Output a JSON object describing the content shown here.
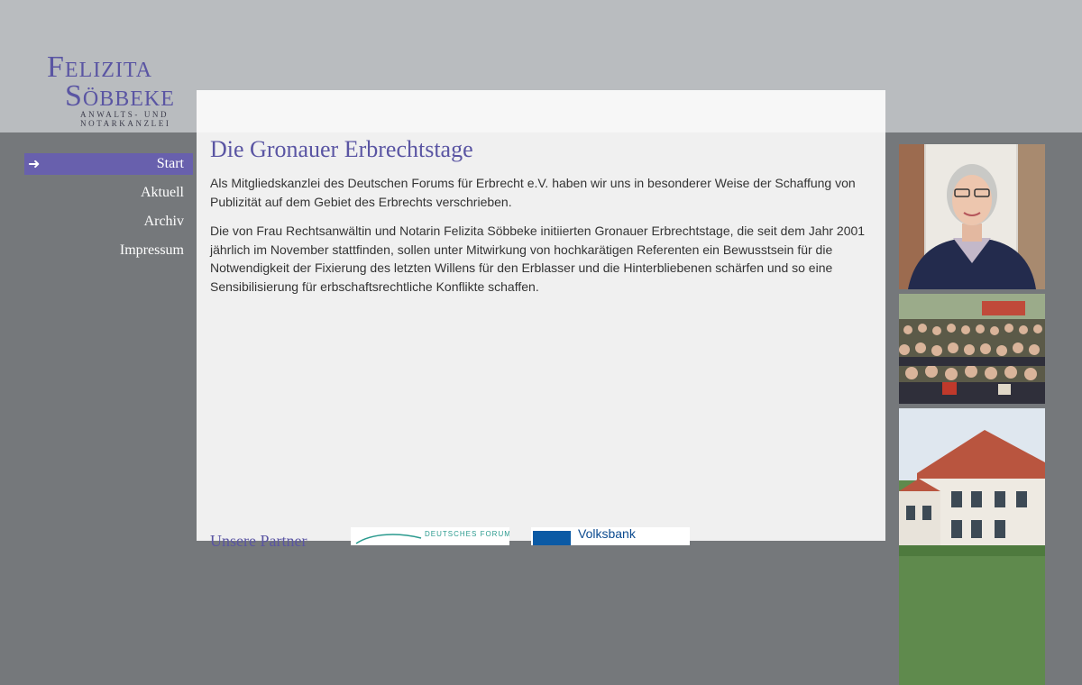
{
  "logo": {
    "line1_first": "F",
    "line1_rest": "ELIZITA",
    "line2_first": "S",
    "line2_rest": "ÖBBEKE",
    "subtitle": "ANWALTS- UND\nNOTARKANZLEI"
  },
  "nav": {
    "items": [
      {
        "label": "Start",
        "active": true
      },
      {
        "label": "Aktuell"
      },
      {
        "label": "Archiv"
      },
      {
        "label": "Impressum"
      }
    ]
  },
  "main": {
    "title": "Die Gronauer Erbrechtstage",
    "paragraphs": [
      "Als Mitgliedskanzlei des Deutschen Forums für Erbrecht e.V. haben wir uns in besonderer Weise der Schaffung von Publizität auf dem Gebiet des Erbrechts verschrieben.",
      "Die von Frau Rechtsanwältin und Notarin Felizita Söbbeke initiierten Gronauer Erbrechtstage, die seit dem Jahr 2001 jährlich im November stattfinden, sollen unter Mitwirkung von hochkarätigen Referenten ein Bewusstsein für die Notwendigkeit der Fixierung des letzten Willens für den Erblasser und die Hinterbliebenen schärfen und so eine Sensibilisierung für erbschaftsrechtliche Konflikte schaffen."
    ],
    "partners_heading": "Unsere Partner",
    "partners": [
      {
        "name": "DEUTSCHES FORUM"
      },
      {
        "name": "Volksbank"
      }
    ]
  },
  "colors": {
    "brand": "#5a55a3",
    "nav_active": "#6860ad",
    "background": "#75787b"
  },
  "icons": [
    "arrow-right-icon"
  ]
}
